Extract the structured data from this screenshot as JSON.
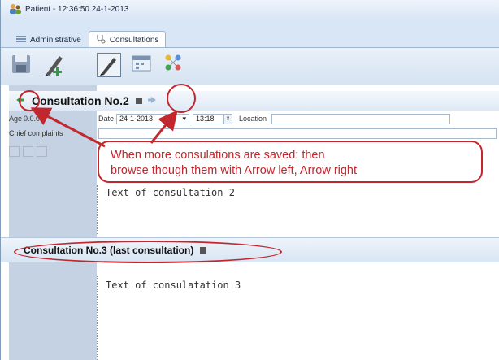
{
  "window": {
    "title": "Patient - 12:36:50 24-1-2013"
  },
  "tabs": [
    {
      "label": "Administrative",
      "icon": "list-icon",
      "active": false
    },
    {
      "label": "Consultations",
      "icon": "stethoscope-icon",
      "active": true
    }
  ],
  "toolbar": {
    "buttons": [
      {
        "name": "save-button",
        "icon": "floppy-disk-icon"
      },
      {
        "name": "new-consultation-button",
        "icon": "pen-plus-icon"
      },
      {
        "name": "edit-button",
        "icon": "pen-icon",
        "pressed": true
      },
      {
        "name": "calendar-button",
        "icon": "calendar-icon"
      },
      {
        "name": "chart-button",
        "icon": "molecule-icon"
      }
    ]
  },
  "consultation2": {
    "title": "Consultation No.2",
    "age_label": "Age",
    "age_value": "0.0.0",
    "date_label": "Date",
    "date_value": "24-1-2013",
    "time_value": "13:18",
    "location_label": "Location",
    "location_value": "",
    "chief_label": "Chief complaints",
    "text": "Text of consultation 2"
  },
  "consultation3": {
    "title": "Consultation No.3 (last consultation)",
    "text": "Text of consulatation 3"
  },
  "callout": {
    "line1": "When more consulations are saved: then",
    "line2": "browse though them with Arrow left, Arrow right"
  },
  "colors": {
    "annotation": "#c1272d",
    "window_bg": "#d9e6f5",
    "left_strip": "#c4d2e4"
  }
}
